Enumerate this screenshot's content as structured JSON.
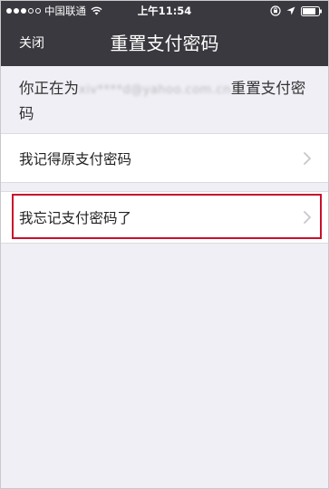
{
  "status_bar": {
    "carrier": "中国联通",
    "time": "上午11:54"
  },
  "nav": {
    "close_label": "关闭",
    "title": "重置支付密码"
  },
  "info": {
    "prefix": "你正在为",
    "email_masked": "xiv****d@yahoo.com.cn",
    "suffix": "重置支付密码"
  },
  "options": [
    {
      "label": "我记得原支付密码"
    },
    {
      "label": "我忘记支付密码了"
    }
  ],
  "colors": {
    "header_bg": "#39393f",
    "page_bg": "#f0eff5",
    "highlight": "#c8102e"
  },
  "icons": [
    "wifi-icon",
    "rotation-lock-icon",
    "location-arrow-icon",
    "chevron-right-icon"
  ]
}
